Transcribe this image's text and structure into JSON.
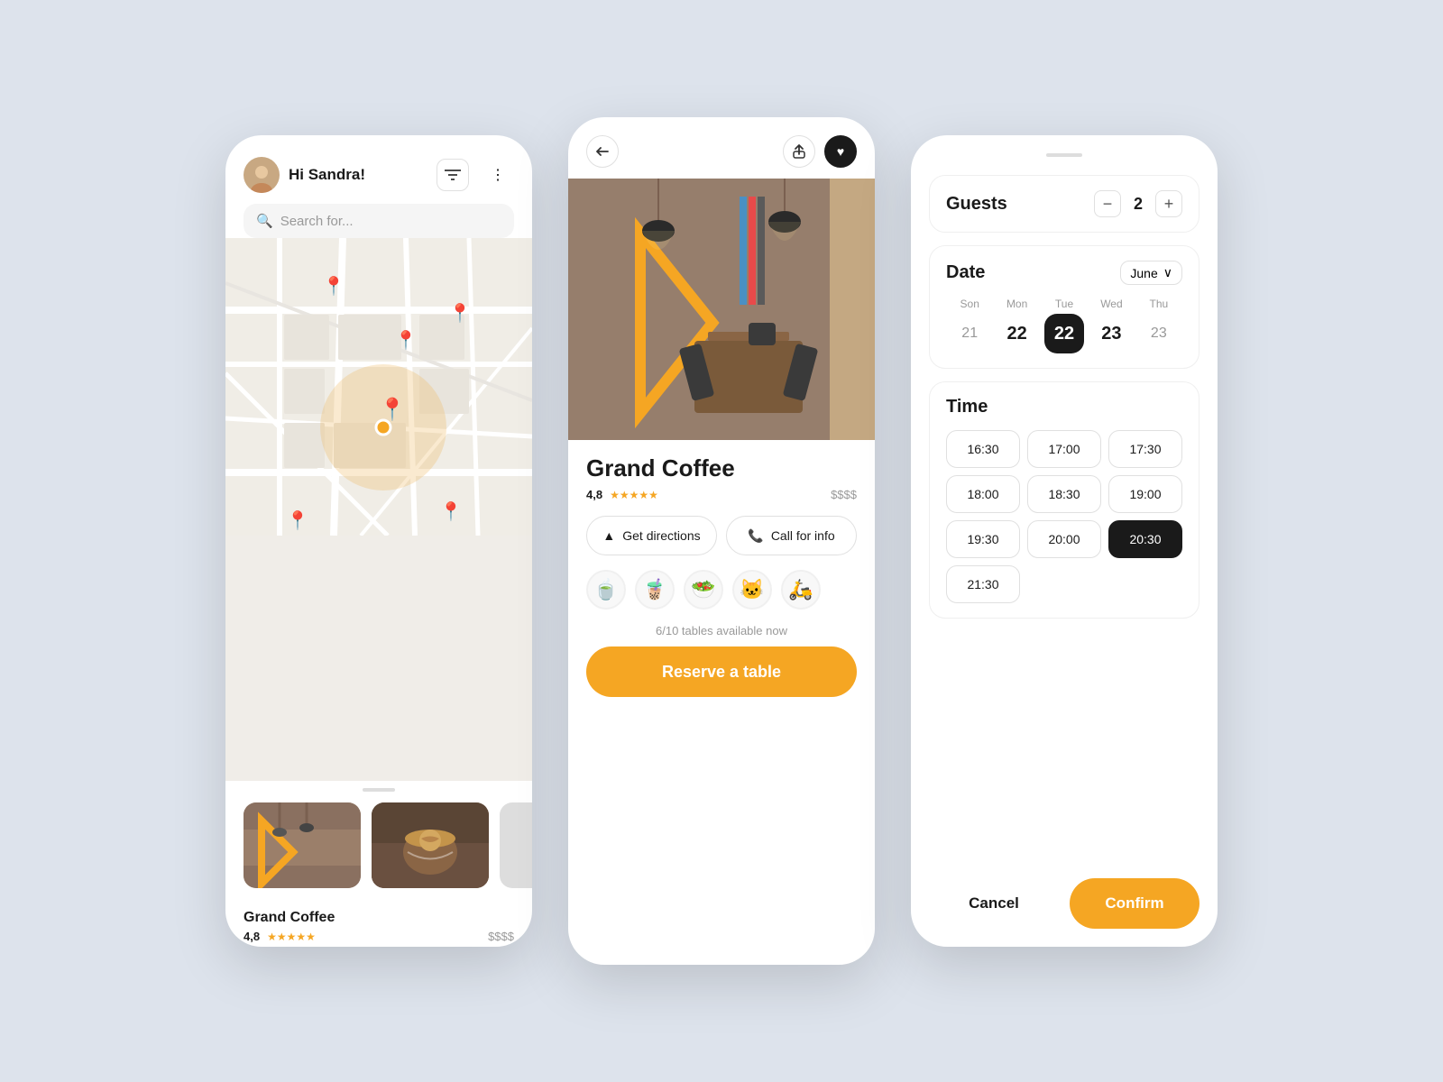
{
  "phone1": {
    "greeting": "Hi Sandra!",
    "search_placeholder": "Search for...",
    "cafe_name": "Grand Coffee",
    "cafe_rating": "4,8",
    "cafe_price": "$$$$"
  },
  "phone2": {
    "restaurant_name": "Grand Coffee",
    "rating": "4,8",
    "price": "$$$$",
    "get_directions_label": "Get directions",
    "call_for_info_label": "Call for info",
    "tables_available": "6/10 tables available now",
    "reserve_label": "Reserve a table",
    "emojis": [
      "🍵",
      "🧋",
      "🥗",
      "🐱",
      "🛵"
    ]
  },
  "phone3": {
    "guests_label": "Guests",
    "guest_count": "2",
    "date_label": "Date",
    "month": "June",
    "days": [
      {
        "name": "Son",
        "num": "21",
        "type": "light"
      },
      {
        "name": "Mon",
        "num": "22",
        "type": "normal"
      },
      {
        "name": "Tue",
        "num": "22",
        "type": "selected"
      },
      {
        "name": "Wed",
        "num": "23",
        "type": "normal"
      },
      {
        "name": "Thu",
        "num": "23",
        "type": "light"
      }
    ],
    "time_label": "Time",
    "times": [
      {
        "value": "16:30",
        "selected": false
      },
      {
        "value": "17:00",
        "selected": false
      },
      {
        "value": "17:30",
        "selected": false
      },
      {
        "value": "18:00",
        "selected": false
      },
      {
        "value": "18:30",
        "selected": false
      },
      {
        "value": "19:00",
        "selected": false
      },
      {
        "value": "19:30",
        "selected": false
      },
      {
        "value": "20:00",
        "selected": false
      },
      {
        "value": "20:30",
        "selected": true
      },
      {
        "value": "21:30",
        "selected": false
      }
    ],
    "cancel_label": "Cancel",
    "confirm_label": "Confirm"
  },
  "icons": {
    "search": "🔍",
    "filter": "⚙",
    "more": "⋯",
    "back": "︿",
    "share": "↑",
    "heart": "♥",
    "directions": "▲",
    "phone": "📞",
    "chevron_down": "∨",
    "minus": "−",
    "plus": "+"
  }
}
